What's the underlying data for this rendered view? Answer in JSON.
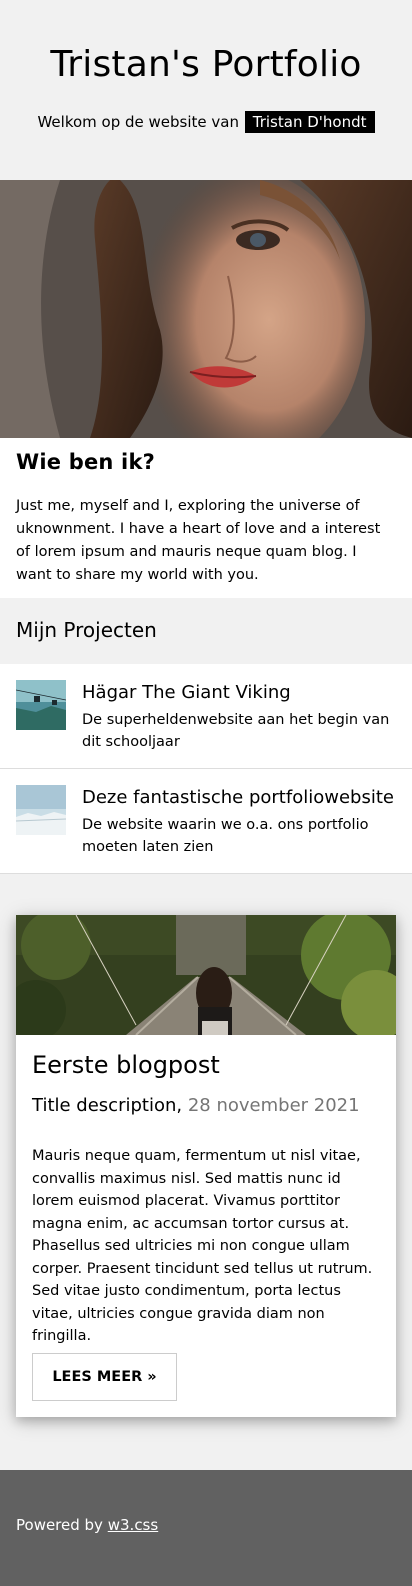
{
  "header": {
    "title": "Tristan's Portfolio",
    "subtitle_prefix": "Welkom op de website van",
    "name": "Tristan D'hondt"
  },
  "about": {
    "heading": "Wie ben ik?",
    "text": "Just me, myself and I, exploring the universe of uknownment. I have a heart of love and a interest of lorem ipsum and mauris neque quam blog. I want to share my world with you."
  },
  "projects": {
    "heading": "Mijn Projecten",
    "items": [
      {
        "title": "Hägar The Giant Viking",
        "description": "De superheldenwebsite aan het begin van dit schooljaar"
      },
      {
        "title": "Deze fantastische portfoliowebsite",
        "description": "De website waarin we o.a. ons portfolio moeten laten zien"
      }
    ]
  },
  "blog": {
    "title": "Eerste blogpost",
    "description": "Title description,",
    "date": "28 november 2021",
    "body": "Mauris neque quam, fermentum ut nisl vitae, convallis maximus nisl. Sed mattis nunc id lorem euismod placerat. Vivamus porttitor magna enim, ac accumsan tortor cursus at. Phasellus sed ultricies mi non congue ullam corper. Praesent tincidunt sed tellus ut rutrum. Sed vitae justo condimentum, porta lectus vitae, ultricies congue gravida diam non fringilla.",
    "button_label": "LEES MEER »"
  },
  "footer": {
    "prefix": "Powered by",
    "link": "w3.css"
  },
  "colors": {
    "page_bg": "#f1f1f1",
    "footer_bg": "#616161",
    "name_badge_bg": "#000000",
    "date_text": "#757575"
  }
}
